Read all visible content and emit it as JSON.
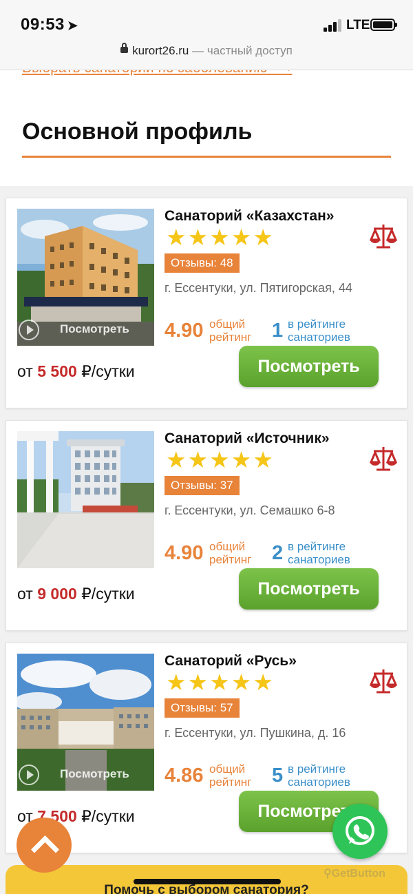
{
  "status": {
    "time": "09:53",
    "network": "LTE"
  },
  "browser": {
    "domain": "kurort26.ru",
    "suffix": "— частный доступ"
  },
  "page": {
    "choose_link": "Выбрать санаторий по заболеванию ⟶",
    "section_title": "Основной профиль"
  },
  "cards": [
    {
      "name": "Санаторий «Казахстан»",
      "stars": "★★★★★",
      "reviews": "Отзывы: 48",
      "address": "г. Ессентуки, ул. Пятигорская, 44",
      "rating": "4.90",
      "rating_label_1": "общий",
      "rating_label_2": "рейтинг",
      "rank": "1",
      "rank_label_1": "в рейтинге",
      "rank_label_2": "санаториев",
      "price_prefix": "от",
      "price_value": "5 500",
      "price_suffix": "₽/сутки",
      "button": "Посмотреть",
      "photo_overlay": "Посмотреть"
    },
    {
      "name": "Санаторий «Источник»",
      "stars": "★★★★★",
      "reviews": "Отзывы: 37",
      "address": "г. Ессентуки, ул. Семашко 6-8",
      "rating": "4.90",
      "rating_label_1": "общий",
      "rating_label_2": "рейтинг",
      "rank": "2",
      "rank_label_1": "в рейтинге",
      "rank_label_2": "санаториев",
      "price_prefix": "от",
      "price_value": "9 000",
      "price_suffix": "₽/сутки",
      "button": "Посмотреть"
    },
    {
      "name": "Санаторий «Русь»",
      "stars": "★★★★★",
      "reviews": "Отзывы: 57",
      "address": "г. Ессентуки, ул. Пушкина, д. 16",
      "rating": "4.86",
      "rating_label_1": "общий",
      "rating_label_2": "рейтинг",
      "rank": "5",
      "rank_label_1": "в рейтинге",
      "rank_label_2": "санаториев",
      "price_prefix": "от",
      "price_value": "7 500",
      "price_suffix": "₽/сутки",
      "button": "Посмотреть",
      "photo_overlay": "Посмотреть"
    }
  ],
  "help_bar": "Помочь с выбором санатория?",
  "getbutton": "GetButton",
  "colors": {
    "accent": "#e8833a",
    "green": "#5aa22d",
    "price_red": "#c52a2a",
    "rank_blue": "#3a8fc9",
    "star": "#f5c518"
  }
}
